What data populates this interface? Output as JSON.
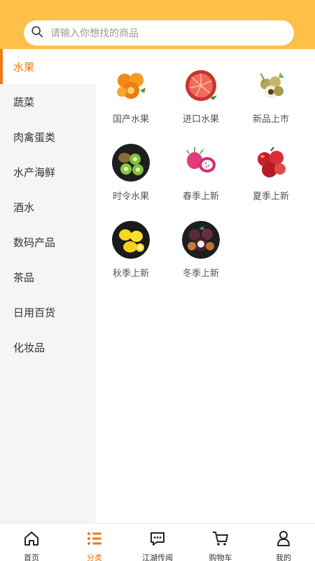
{
  "search": {
    "placeholder": "请输入你想找的商品"
  },
  "sidebar": {
    "items": [
      {
        "label": "水果",
        "active": true
      },
      {
        "label": "蔬菜"
      },
      {
        "label": "肉禽蛋类"
      },
      {
        "label": "水产海鲜"
      },
      {
        "label": "酒水"
      },
      {
        "label": "数码产品"
      },
      {
        "label": "茶品"
      },
      {
        "label": "日用百货"
      },
      {
        "label": "化妆品"
      }
    ]
  },
  "categories": [
    {
      "label": "国产水果",
      "icon": "orange-fruit-icon"
    },
    {
      "label": "进口水果",
      "icon": "grapefruit-icon"
    },
    {
      "label": "新品上市",
      "icon": "longan-fruit-icon"
    },
    {
      "label": "时令水果",
      "icon": "kiwi-fruit-icon"
    },
    {
      "label": "春季上新",
      "icon": "dragon-fruit-icon"
    },
    {
      "label": "夏季上新",
      "icon": "red-apple-icon"
    },
    {
      "label": "秋季上新",
      "icon": "lemon-fruit-icon"
    },
    {
      "label": "冬季上新",
      "icon": "mangosteen-icon"
    }
  ],
  "tabbar": {
    "items": [
      {
        "label": "首页",
        "icon": "home-icon"
      },
      {
        "label": "分类",
        "icon": "category-list-icon",
        "active": true
      },
      {
        "label": "江湖传闻",
        "icon": "chat-bubble-icon"
      },
      {
        "label": "购物车",
        "icon": "cart-icon"
      },
      {
        "label": "我的",
        "icon": "profile-icon"
      }
    ]
  },
  "colors": {
    "header": "#ffc04a",
    "accent": "#f07a12",
    "sidebar_bg": "#f5f5f5"
  }
}
